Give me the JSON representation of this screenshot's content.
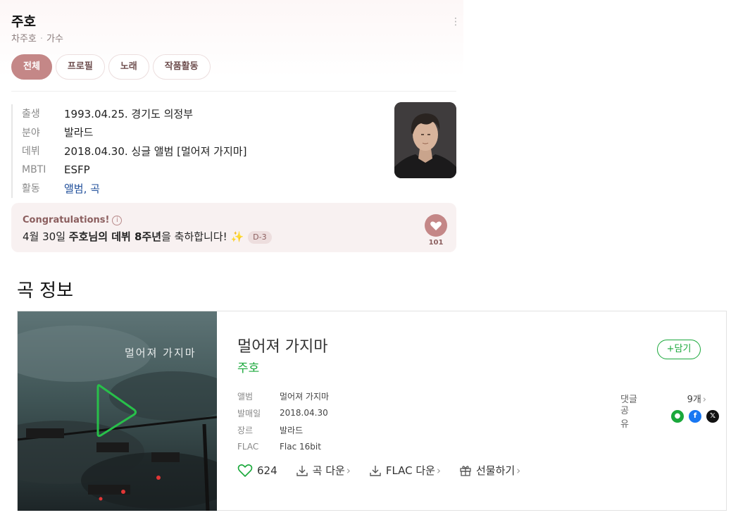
{
  "profile": {
    "name": "주호",
    "real_name": "차주호",
    "role": "가수",
    "tabs": [
      "전체",
      "프로필",
      "노래",
      "작품활동"
    ],
    "active_tab": "전체",
    "info": {
      "birth_label": "출생",
      "birth_value": "1993.04.25. 경기도 의정부",
      "genre_label": "분야",
      "genre_value": "발라드",
      "debut_label": "데뷔",
      "debut_value": "2018.04.30. 싱글 앨범 [멀어져 가지마]",
      "mbti_label": "MBTI",
      "mbti_value": "ESFP",
      "activity_label": "활동",
      "activity_album": "앨범",
      "activity_sep": ", ",
      "activity_song": "곡"
    }
  },
  "congrats": {
    "title": "Congratulations!",
    "msg_prefix": "4월 30일 ",
    "msg_name": "주호",
    "msg_mid1": "님의 ",
    "msg_bold": "데뷔 8주년",
    "msg_suffix": "을 축하합니다! ✨",
    "badge": "D-3",
    "likes": "101"
  },
  "song_section": {
    "title": "곡 정보",
    "song_title": "멀어져 가지마",
    "artist": "주호",
    "add_label": "담기",
    "meta": {
      "album_label": "앨범",
      "album_value": "멀어져 가지마",
      "release_label": "발매일",
      "release_value": "2018.04.30",
      "genre_label": "장르",
      "genre_value": "발라드",
      "flac_label": "FLAC",
      "flac_value": "Flac 16bit"
    },
    "comments_label": "댓글",
    "comments_value": "9개",
    "share_label": "공유",
    "like_count": "624",
    "download_label": "곡 다운",
    "flac_download_label": "FLAC 다운",
    "gift_label": "선물하기",
    "cover_text": "멀어져 가지마"
  },
  "colors": {
    "accent": "#c48787",
    "melon_green": "#1aa83b"
  }
}
